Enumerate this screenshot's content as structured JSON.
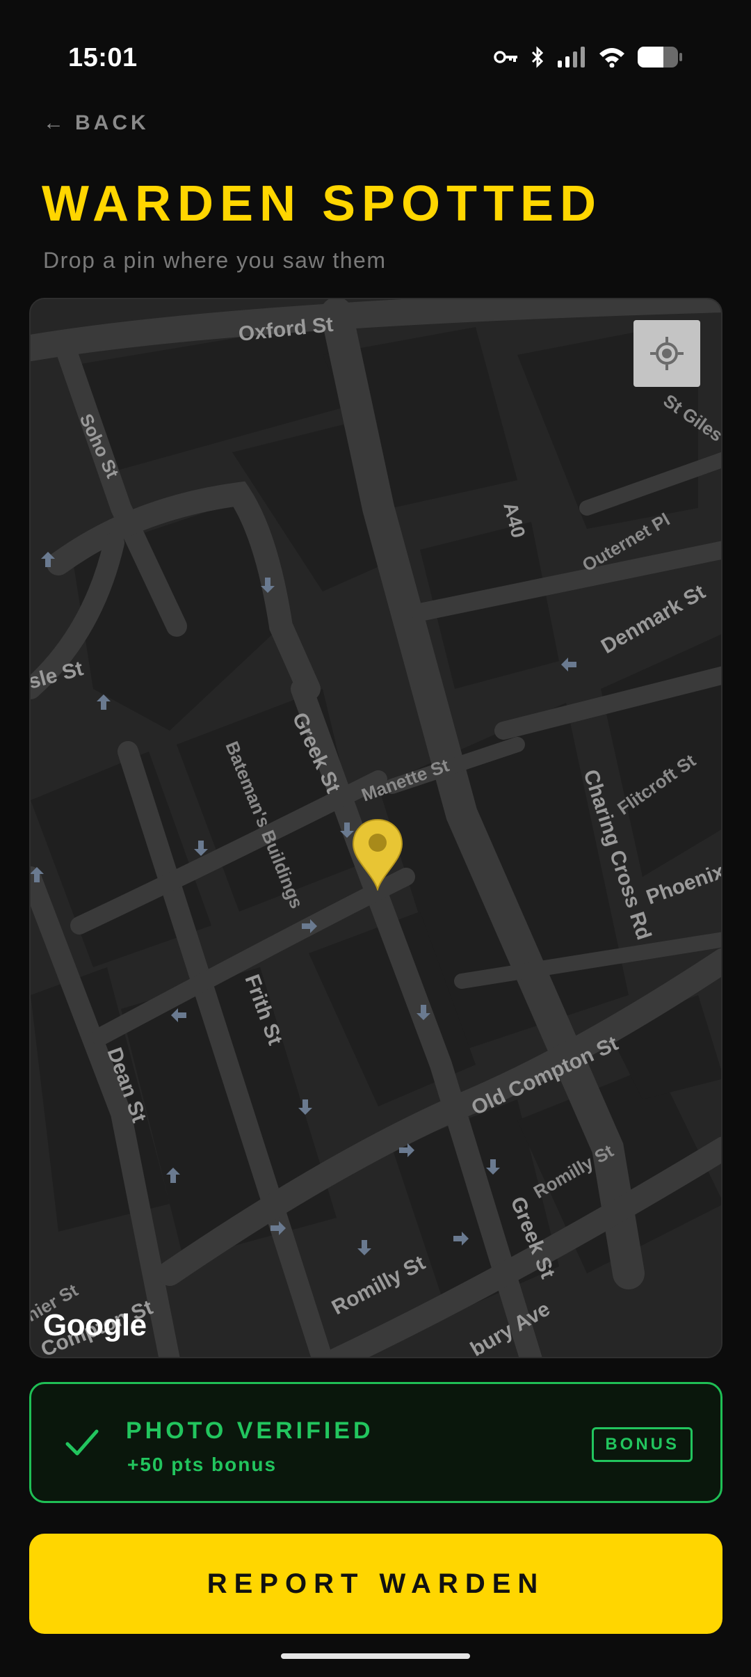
{
  "status_bar": {
    "time": "15:01",
    "icons": [
      "vpn-key-icon",
      "bluetooth-icon",
      "signal-icon",
      "wifi-icon",
      "battery-icon"
    ]
  },
  "nav": {
    "back_arrow": "←",
    "back_label": "BACK"
  },
  "header": {
    "title": "WARDEN SPOTTED",
    "subtitle": "Drop a pin where you saw them"
  },
  "map": {
    "attribution": "Google",
    "streets": [
      "Oxford St",
      "Soho St",
      "A40",
      "St Giles",
      "Outernet Pl",
      "Denmark St",
      "sle St",
      "Greek St",
      "Bateman's Buildings",
      "Manette St",
      "Charing Cross Rd",
      "Flitcroft St",
      "Phoenix",
      "Frith St",
      "Dean St",
      "Old Compton St",
      "Romilly St",
      "Romilly St",
      "Greek St",
      "nier St",
      "Compton St",
      "bury Ave"
    ],
    "pin_color": "#e8c534"
  },
  "verification": {
    "title": "PHOTO VERIFIED",
    "subtitle": "+50 pts bonus",
    "badge": "BONUS"
  },
  "actions": {
    "report_label": "REPORT WARDEN"
  },
  "colors": {
    "accent": "#ffd600",
    "success": "#22c55e",
    "background": "#0c0c0c"
  }
}
